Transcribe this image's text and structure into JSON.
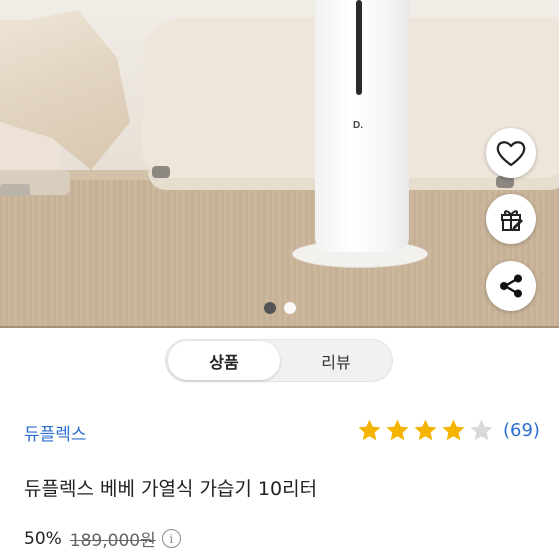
{
  "gallery": {
    "product_logo_text": "D.",
    "pagination": {
      "current": 1,
      "total": 2
    }
  },
  "actions": {
    "wishlist_icon": "heart-icon",
    "gift_icon": "gift-icon",
    "share_icon": "share-icon"
  },
  "tabs": [
    {
      "label": "상품",
      "active": true
    },
    {
      "label": "리뷰",
      "active": false
    }
  ],
  "product": {
    "brand": "듀플렉스",
    "title": "듀플렉스 베베 가열식 가습기 10리터",
    "rating": {
      "stars_filled": 4,
      "stars_total": 5,
      "review_count": "(69)"
    },
    "price": {
      "discount": "50%",
      "original": "189,000원"
    }
  },
  "colors": {
    "accent": "#2b6fd0",
    "star": "#f5b400",
    "star_empty": "#d9d9d9"
  }
}
